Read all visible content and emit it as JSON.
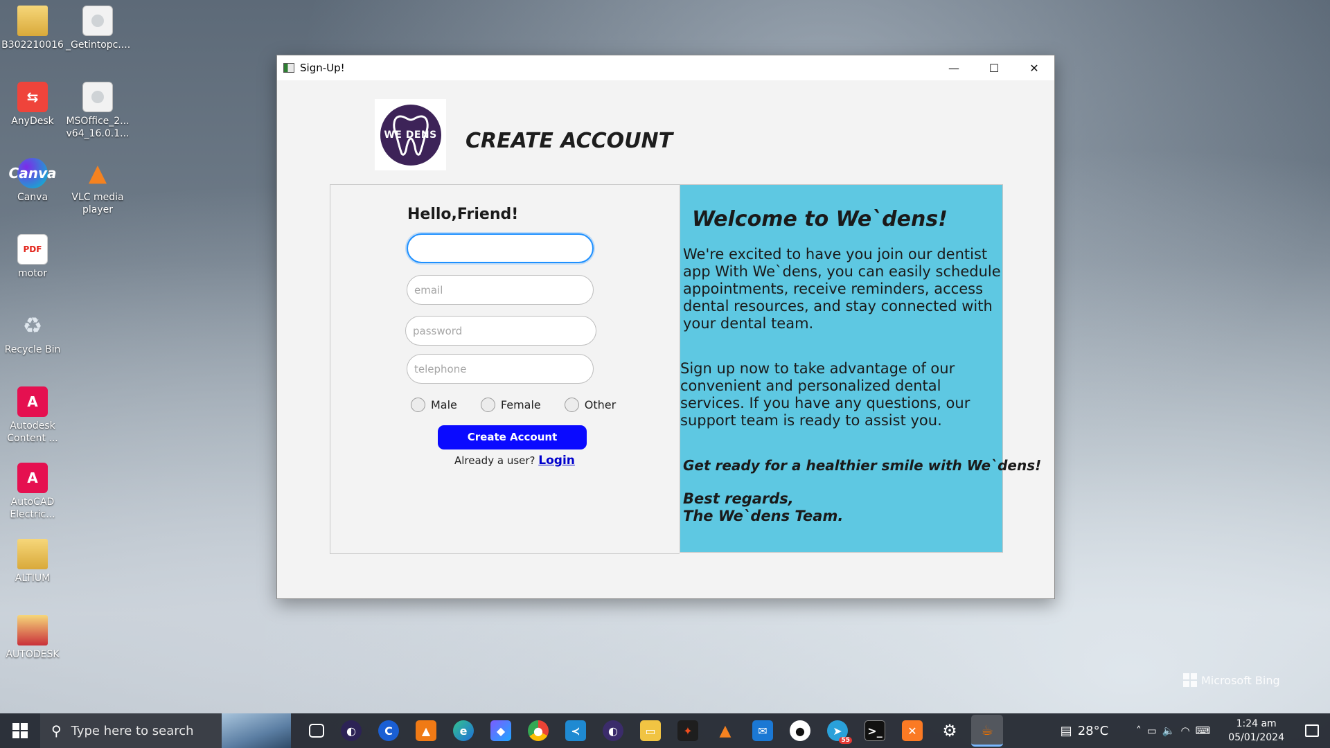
{
  "desktop": {
    "icons": [
      {
        "label": "B302210016",
        "glyph": ""
      },
      {
        "label": "_Getintopc....",
        "glyph": ""
      },
      {
        "label": "AnyDesk",
        "glyph": "⇆"
      },
      {
        "label": "MSOffice_2... v64_16.0.1...",
        "glyph": ""
      },
      {
        "label": "Canva",
        "glyph": "Canva"
      },
      {
        "label": "VLC media player",
        "glyph": "▲"
      },
      {
        "label": "motor",
        "glyph": "PDF"
      },
      {
        "label": "Recycle Bin",
        "glyph": "♻"
      },
      {
        "label": "Autodesk Content ...",
        "glyph": "A"
      },
      {
        "label": "AutoCAD Electric...",
        "glyph": "A"
      },
      {
        "label": "ALTIUM",
        "glyph": ""
      },
      {
        "label": "AUTODESK",
        "glyph": ""
      }
    ]
  },
  "window": {
    "title": "Sign-Up!",
    "controls": {
      "minimize": "—",
      "maximize": "☐",
      "close": "✕"
    }
  },
  "logo": {
    "text": "WE DENS",
    "color": "#3d2358"
  },
  "header": {
    "title": "CREATE ACCOUNT"
  },
  "form": {
    "greeting": "Hello,Friend!",
    "name_value": "",
    "email_placeholder": "email",
    "password_placeholder": "password",
    "telephone_placeholder": "telephone",
    "gender_options": [
      "Male",
      "Female",
      "Other"
    ],
    "create_button": "Create Account",
    "already_text": "Already a user?",
    "login_link": "Login",
    "button_color": "#0a0aff"
  },
  "info": {
    "title": "Welcome to We`dens!",
    "paragraph1": "We're excited to have you join our dentist app With We`dens, you can easily schedule appointments, receive reminders, access dental resources, and stay connected with your dental team.",
    "paragraph2": "Sign up now to take advantage of our convenient and personalized dental services. If you have any questions, our support team is ready to assist you.",
    "tagline": "Get ready for a healthier smile with We`dens!",
    "signoff_line1": "Best regards,",
    "signoff_line2": "The We`dens Team.",
    "background_color": "#5ec8e2"
  },
  "watermark": {
    "text": "Microsoft Bing"
  },
  "taskbar": {
    "search_placeholder": "Type here to search",
    "weather": "28°C",
    "time": "1:24 am",
    "date": "05/01/2024",
    "telegram_badge": "55"
  }
}
